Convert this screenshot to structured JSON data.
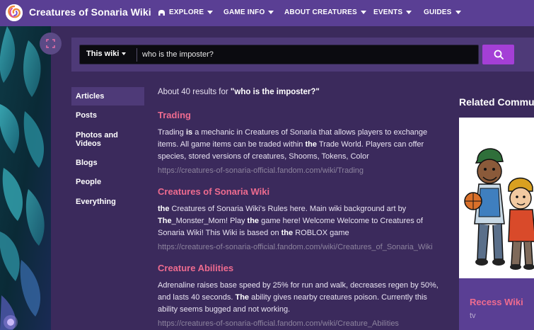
{
  "header": {
    "site_title": "Creatures of Sonaria Wiki",
    "nav": [
      {
        "label": "EXPLORE",
        "icon": "compass-icon"
      },
      {
        "label": "GAME INFO"
      },
      {
        "label": "ABOUT CREATURES"
      },
      {
        "label": "EVENTS"
      },
      {
        "label": "GUIDES"
      }
    ]
  },
  "search": {
    "scope_label": "This wiki",
    "query": "who is the imposter?"
  },
  "filters": [
    "Articles",
    "Posts",
    "Photos and Videos",
    "Blogs",
    "People",
    "Everything"
  ],
  "summary": {
    "prefix": "About 40 results for ",
    "query": "\"who is the imposter?\""
  },
  "results": [
    {
      "title": "Trading",
      "snippet_html": "Trading <b>is</b> a mechanic in Creatures of Sonaria that allows players to exchange items. All game items can be traded within <b>the</b> Trade World. Players can offer species, stored versions of creatures, Shooms, Tokens, Color",
      "url": "https://creatures-of-sonaria-official.fandom.com/wiki/Trading"
    },
    {
      "title": "Creatures of Sonaria Wiki",
      "snippet_html": "<b>the</b> Creatures of Sonaria Wiki's Rules here. Main wiki background art by <b>The</b>_Monster_Mom! Play <b>the</b> game here! Welcome Welcome to Creatures of Sonaria Wiki! This Wiki is based on <b>the</b> ROBLOX game",
      "url": "https://creatures-of-sonaria-official.fandom.com/wiki/Creatures_of_Sonaria_Wiki"
    },
    {
      "title": "Creature Abilities",
      "snippet_html": "Adrenaline raises base speed by 25% for run and walk, decreases regen by 50%, and lasts 40 seconds. <b>The</b> ability gives nearby creatures poison. Currently this ability seems bugged and not working.",
      "url": "https://creatures-of-sonaria-official.fandom.com/wiki/Creature_Abilities"
    }
  ],
  "related": {
    "heading": "Related Community",
    "card_title": "Recess Wiki",
    "card_subtitle": "tv"
  },
  "colors": {
    "nav_bg": "#5a3f94",
    "page_bg": "#3b2a5c",
    "accent_title": "#ee6b8f",
    "search_button": "#a43fd6"
  }
}
